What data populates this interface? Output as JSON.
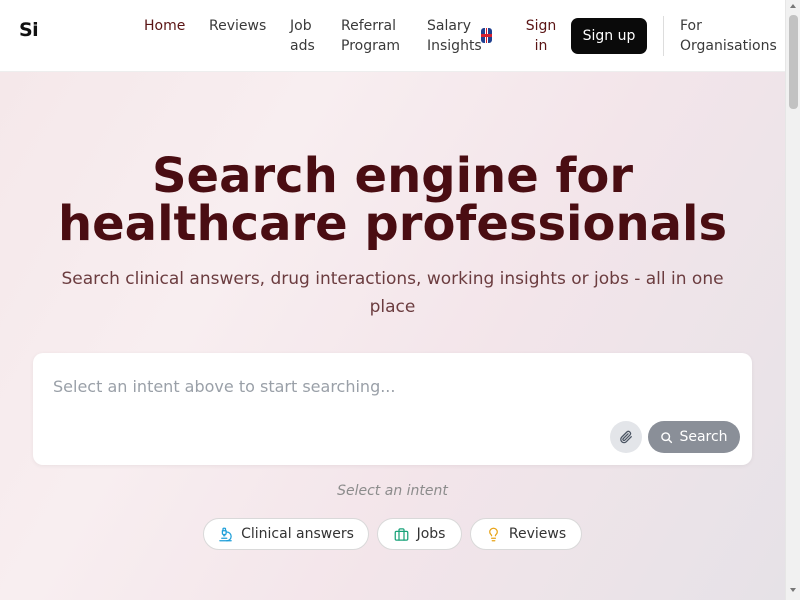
{
  "header": {
    "logo": "Si",
    "nav": {
      "home": "Home",
      "reviews": "Reviews",
      "job_ads": "Job ads",
      "referral": "Referral Program",
      "salary": "Salary Insights",
      "sign_in": "Sign in",
      "sign_up": "Sign up",
      "organisations": "For Organisations"
    }
  },
  "hero": {
    "title": "Search engine for healthcare professionals",
    "subtitle": "Search clinical answers, drug interactions, working insights or jobs - all in one place"
  },
  "search": {
    "placeholder": "Select an intent above to start searching...",
    "button_label": "Search",
    "attach_icon": "paperclip-icon",
    "search_icon": "search-icon"
  },
  "intents": {
    "label": "Select an intent",
    "options": [
      {
        "label": "Clinical answers",
        "icon": "microscope-icon",
        "color": "#1f9fd9"
      },
      {
        "label": "Jobs",
        "icon": "briefcase-icon",
        "color": "#1aa37a"
      },
      {
        "label": "Reviews",
        "icon": "lightbulb-icon",
        "color": "#e8a317"
      }
    ]
  },
  "colors": {
    "title": "#4a0d12",
    "accent": "#5a1414",
    "signup_bg": "#0a0a0a",
    "search_button": "#8a8f98"
  }
}
